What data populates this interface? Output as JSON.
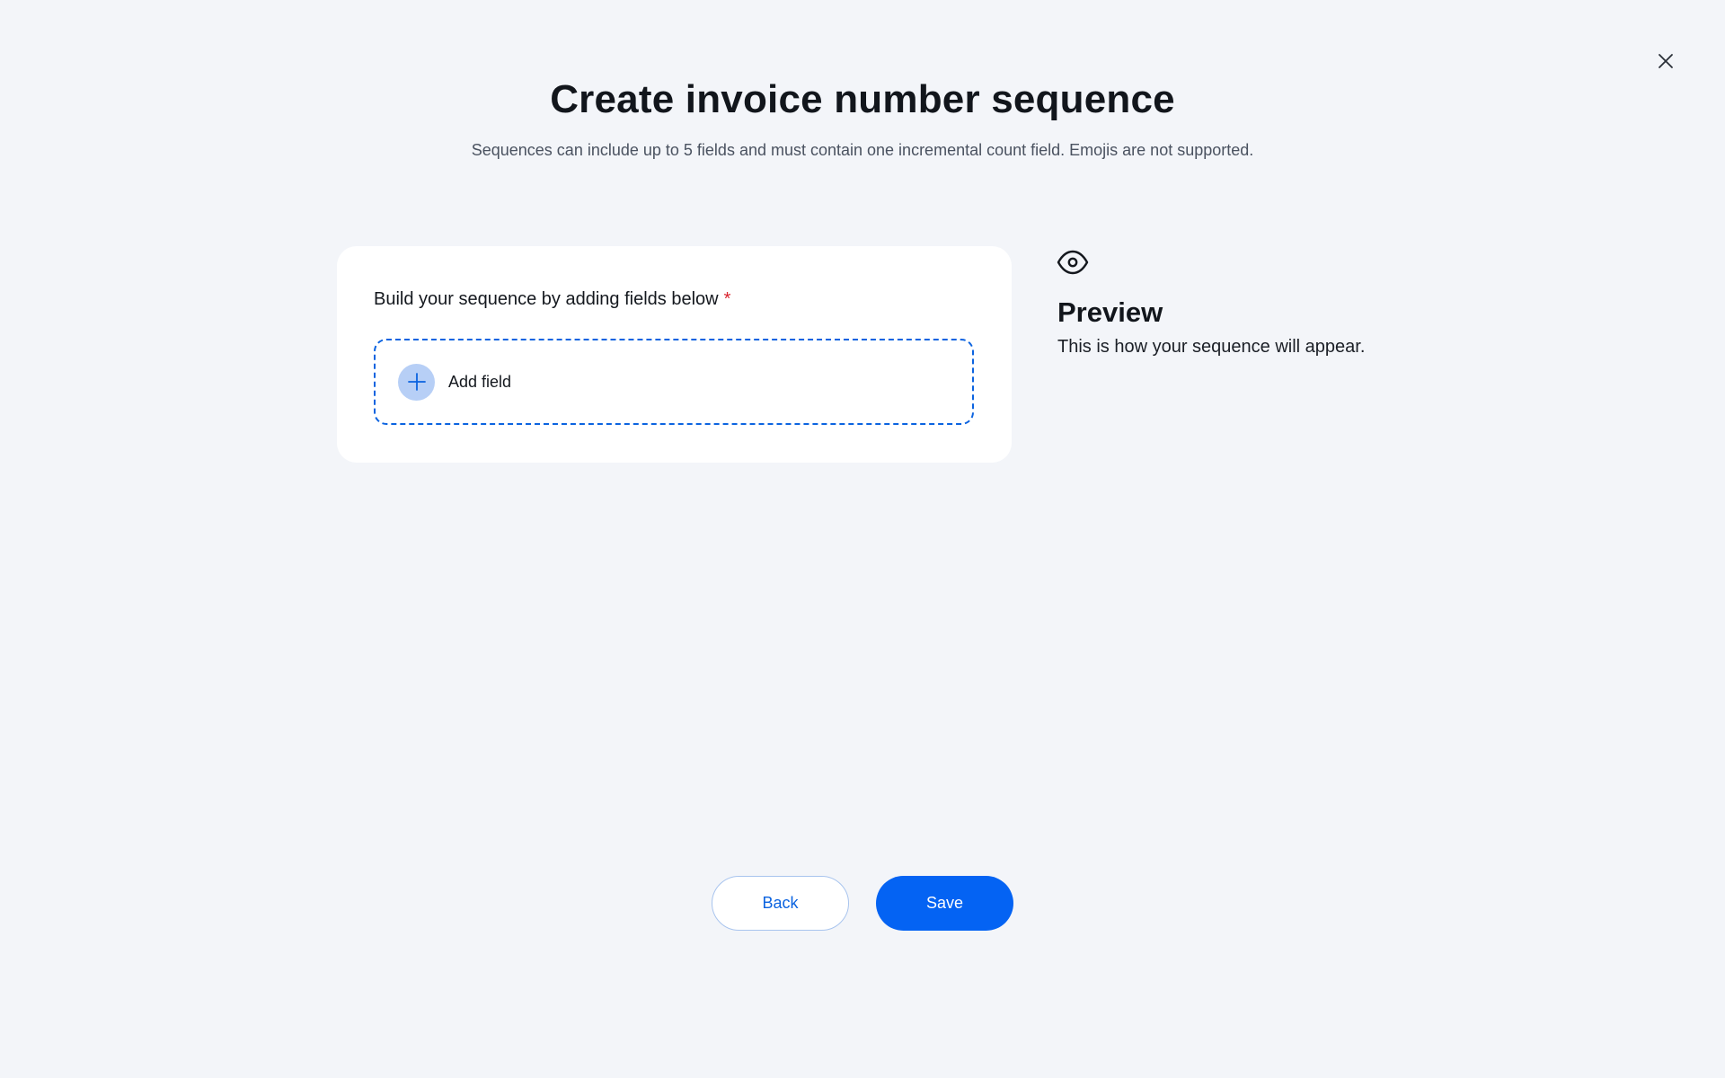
{
  "dialog": {
    "title": "Create invoice number sequence",
    "subtitle": "Sequences can include up to 5 fields and must contain one incremental count field. Emojis are not supported.",
    "close_icon": "close-icon"
  },
  "builder": {
    "label": "Build your sequence by adding fields below",
    "required_mark": "*",
    "add_field_label": "Add field",
    "add_icon": "plus-icon"
  },
  "preview": {
    "icon": "eye-icon",
    "title": "Preview",
    "description": "This is how your sequence will appear."
  },
  "footer": {
    "back_label": "Back",
    "save_label": "Save"
  },
  "colors": {
    "background": "#f3f5f9",
    "accent": "#0463f3",
    "dashed_border": "#0b63e0",
    "required": "#d9232e"
  }
}
